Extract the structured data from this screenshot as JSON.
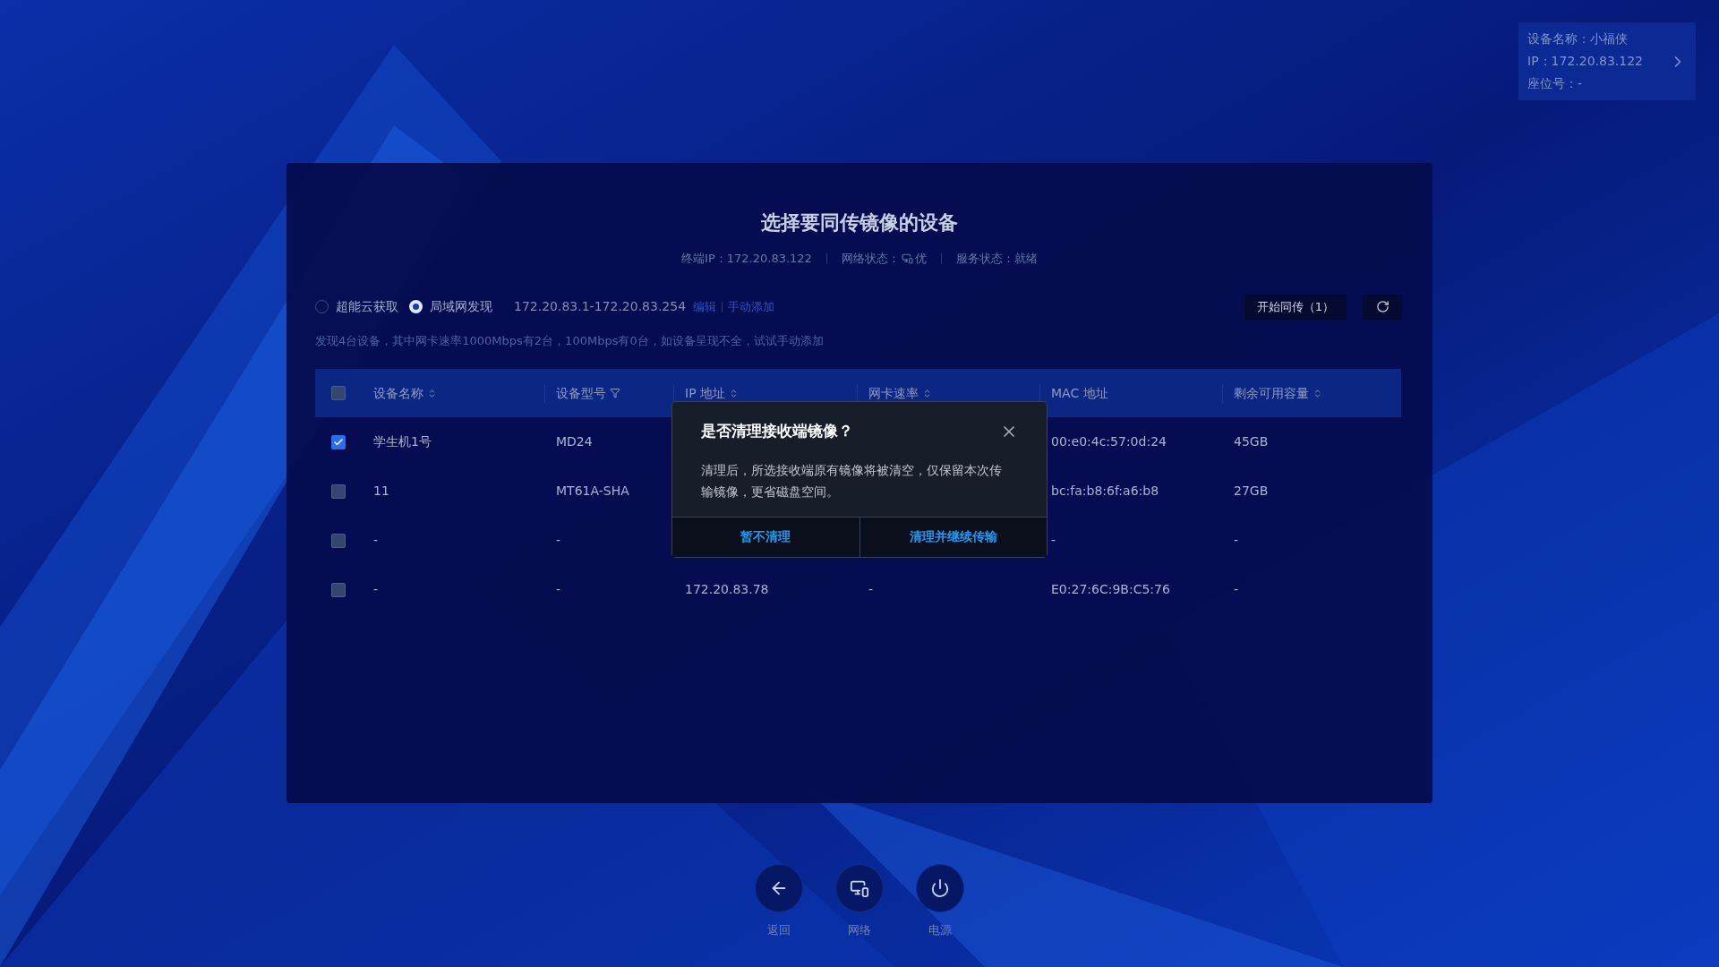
{
  "device_info": {
    "lines": [
      "设备名称：小福侠",
      "IP：172.20.83.122",
      "座位号：-"
    ]
  },
  "panel": {
    "title": "选择要同传镜像的设备",
    "status": [
      {
        "kind": "text",
        "label": "终端IP：172.20.83.122"
      },
      {
        "kind": "network",
        "label": "网络状态：",
        "value": "优"
      },
      {
        "kind": "text",
        "label": "服务状态：就绪"
      }
    ],
    "sources": [
      {
        "label": "超能云获取",
        "selected": false
      },
      {
        "label": "局域网发现",
        "selected": true
      }
    ],
    "ip_range": "172.20.83.1-172.20.83.254",
    "links": [
      "编辑",
      "手动添加"
    ],
    "start_button": "开始同传（1）",
    "summary": "发现4台设备，其中网卡速率1000Mbps有2台，100Mbps有0台，如设备呈现不全，试试手动添加"
  },
  "table": {
    "header_checked": false,
    "columns": [
      {
        "label": "设备名称",
        "kind": "sortable"
      },
      {
        "label": "设备型号",
        "kind": "filterable"
      },
      {
        "label": "IP 地址",
        "kind": "sortable"
      },
      {
        "label": "网卡速率",
        "kind": "sortable"
      },
      {
        "label": "MAC 地址",
        "kind": "plain"
      },
      {
        "label": "剩余可用容量",
        "kind": "sortable"
      }
    ],
    "rows": [
      {
        "checked": true,
        "cells": [
          "学生机1号",
          "MD24",
          null,
          null,
          "00:e0:4c:57:0d:24",
          "45GB"
        ]
      },
      {
        "checked": false,
        "cells": [
          "11",
          "MT61A-SHA",
          null,
          null,
          "bc:fa:b8:6f:a6:b8",
          "27GB"
        ]
      },
      {
        "checked": false,
        "cells": [
          "-",
          "-",
          null,
          null,
          "-",
          "-"
        ]
      },
      {
        "checked": false,
        "cells": [
          "-",
          "-",
          "172.20.83.78",
          "-",
          "E0:27:6C:9B:C5:76",
          "-"
        ]
      }
    ]
  },
  "dialog": {
    "title": "是否清理接收端镜像？",
    "message": "清理后，所选接收端原有镜像将被清空，仅保留本次传输镜像，更省磁盘空间。",
    "buttons": [
      "暂不清理",
      "清理并继续传输"
    ]
  },
  "dock": [
    {
      "kind": "back",
      "label": "返回"
    },
    {
      "kind": "network",
      "label": "网络"
    },
    {
      "kind": "power",
      "label": "电源"
    }
  ]
}
